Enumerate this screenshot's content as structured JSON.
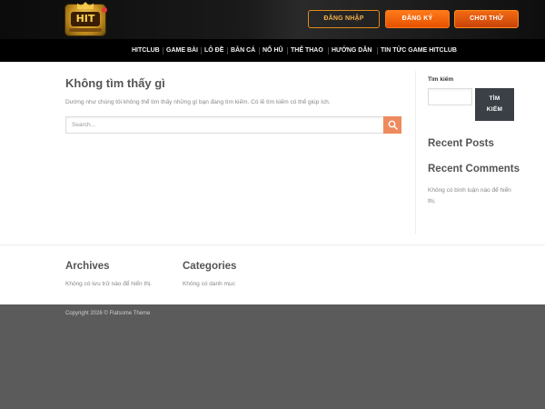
{
  "header": {
    "logo_text": "HIT",
    "buttons": {
      "login": "ĐĂNG NHẬP",
      "register": "ĐĂNG KÝ",
      "play": "CHƠI THỬ"
    }
  },
  "nav": {
    "items": [
      {
        "label": "HITCLUB"
      },
      {
        "label": "GAME BÀI"
      },
      {
        "label": "LÔ ĐỀ"
      },
      {
        "label": "BẮN CÁ"
      },
      {
        "label": "NỔ HŨ"
      },
      {
        "label": "THỂ THAO"
      },
      {
        "label": "HƯỚNG DẪN"
      },
      {
        "label": "TIN TỨC GAME HITCLUB"
      }
    ]
  },
  "main": {
    "title": "Không tìm thấy gì",
    "description": "Dường như chúng tôi không thể tìm thấy những gì bạn đang tìm kiếm. Có lẽ tìm kiếm có thể giúp ích.",
    "search_placeholder": "Search..."
  },
  "sidebar": {
    "search_label": "Tìm kiếm",
    "search_button_line1": "TÌM",
    "search_button_line2": "KIẾM",
    "recent_posts_title": "Recent Posts",
    "recent_comments_title": "Recent Comments",
    "recent_comments_text": "Không có bình luận nào để hiển thị."
  },
  "footer": {
    "archives_title": "Archives",
    "archives_text": "Không có lưu trữ nào để hiển thị.",
    "categories_title": "Categories",
    "categories_text": "Không có danh mục",
    "copyright": "Copyright 2026 © Flatsome Theme"
  },
  "colors": {
    "accent_orange": "#ee8a5e",
    "nav_bg": "#000000",
    "footer_bg": "#5b5b5b"
  }
}
